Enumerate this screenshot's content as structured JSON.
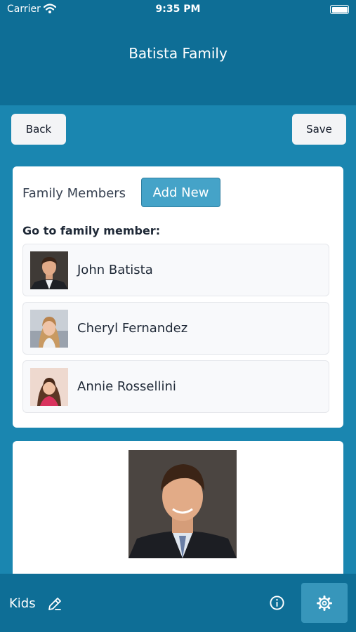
{
  "status_bar": {
    "carrier": "Carrier",
    "time": "9:35 PM"
  },
  "header": {
    "title": "Batista Family"
  },
  "toolbar": {
    "back_label": "Back",
    "save_label": "Save"
  },
  "members_card": {
    "section_label": "Family Members",
    "add_new_label": "Add New",
    "goto_label": "Go to family member:",
    "members": [
      {
        "name": "John Batista"
      },
      {
        "name": "Cheryl Fernandez"
      },
      {
        "name": "Annie Rossellini"
      }
    ]
  },
  "tab_bar": {
    "kids_label": "Kids",
    "icons": [
      "pencil-icon",
      "info-icon",
      "gear-icon"
    ]
  },
  "colors": {
    "header_bg": "#0e6e96",
    "page_bg": "#1a86b0",
    "add_new_bg": "#45a3c8",
    "settings_tab_bg": "#3796bb"
  }
}
